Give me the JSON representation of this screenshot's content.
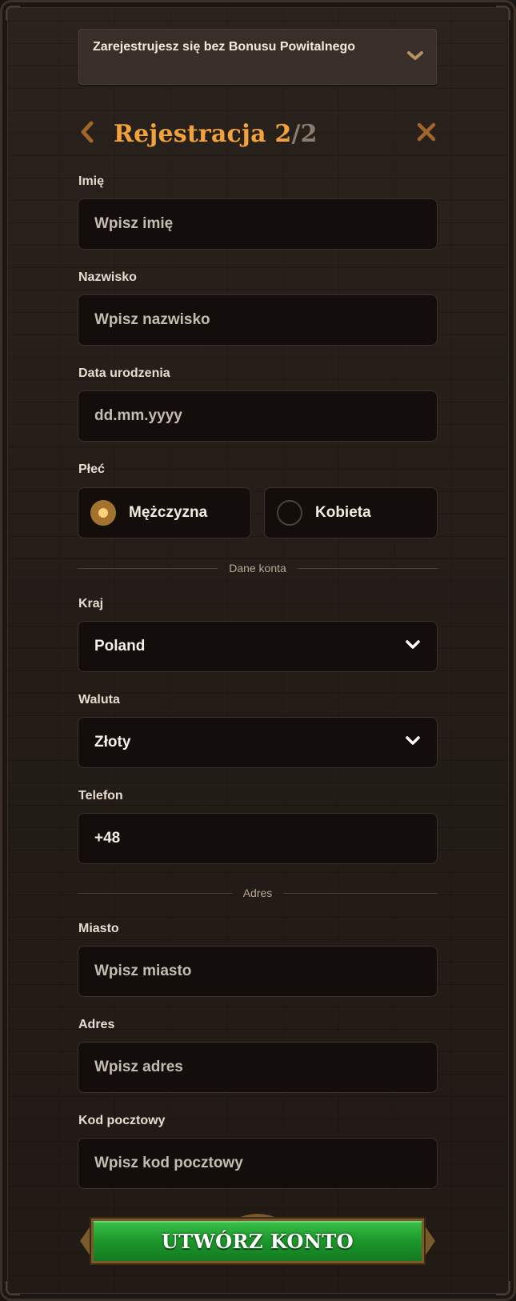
{
  "bonus_banner": {
    "text": "Zarejestrujesz się bez Bonusu Powitalnego",
    "icon": "chevron-down-icon"
  },
  "header": {
    "title": "Rejestracja",
    "step_current": "2",
    "step_separator": "/",
    "step_total": "2",
    "back_icon": "chevron-left-icon",
    "close_icon": "close-icon"
  },
  "fields": {
    "first_name": {
      "label": "Imię",
      "placeholder": "Wpisz imię"
    },
    "last_name": {
      "label": "Nazwisko",
      "placeholder": "Wpisz nazwisko"
    },
    "birth_date": {
      "label": "Data urodzenia",
      "placeholder": "dd.mm.yyyy"
    },
    "gender": {
      "label": "Płeć",
      "options": [
        {
          "label": "Mężczyzna",
          "selected": true
        },
        {
          "label": "Kobieta",
          "selected": false
        }
      ]
    },
    "country": {
      "label": "Kraj",
      "value": "Poland"
    },
    "currency": {
      "label": "Waluta",
      "value": "Złoty"
    },
    "phone": {
      "label": "Telefon",
      "value": "+48"
    },
    "city": {
      "label": "Miasto",
      "placeholder": "Wpisz miasto"
    },
    "address": {
      "label": "Adres",
      "placeholder": "Wpisz adres"
    },
    "postal_code": {
      "label": "Kod pocztowy",
      "placeholder": "Wpisz kod pocztowy"
    }
  },
  "sections": {
    "account": "Dane konta",
    "address": "Adres"
  },
  "submit": {
    "label": "UTWÓRZ KONTO"
  },
  "colors": {
    "accent": "#f1a23b",
    "button": "#1f9a2d",
    "background": "#231c17",
    "input_bg": "#130e0b"
  }
}
